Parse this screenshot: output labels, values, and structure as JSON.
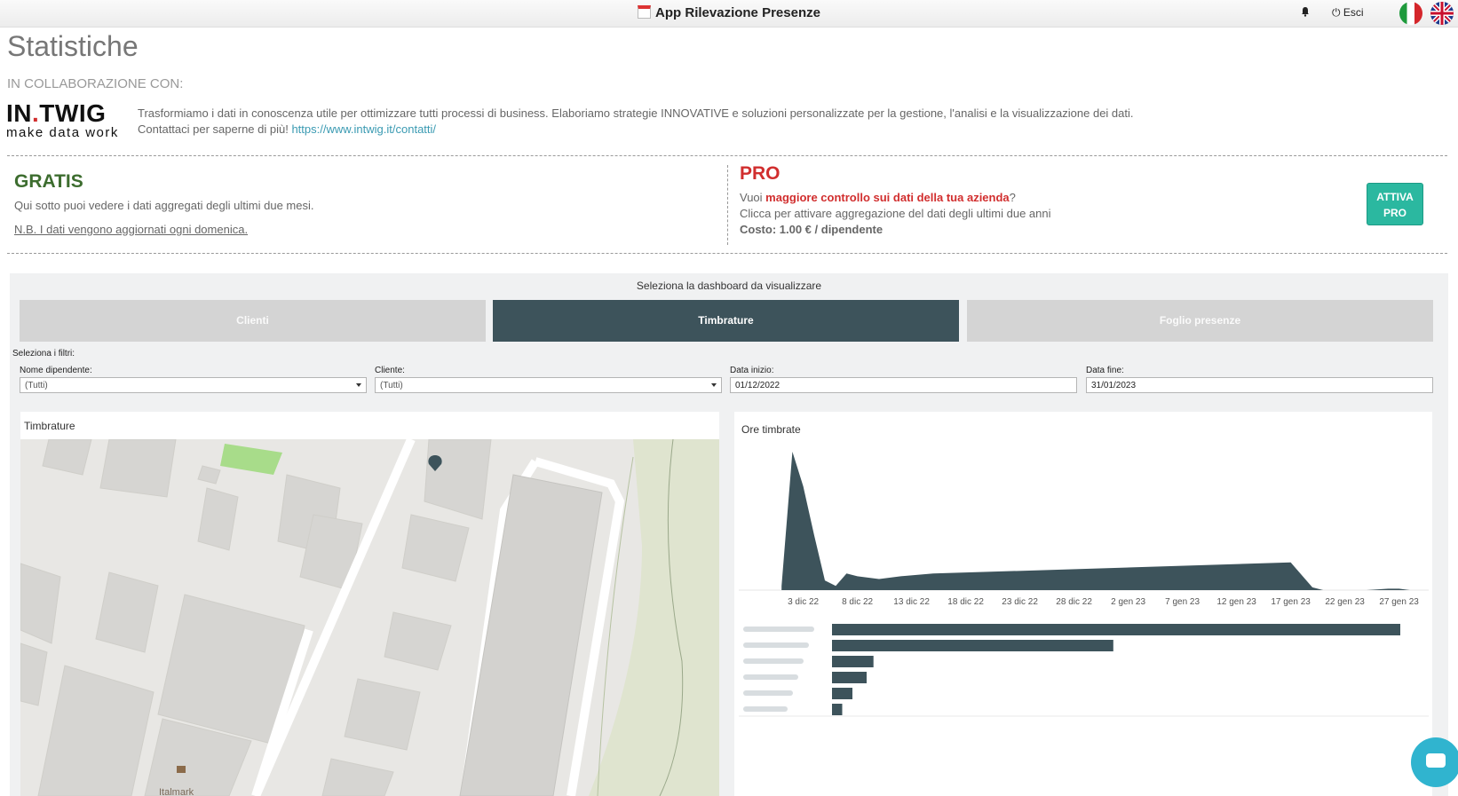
{
  "header": {
    "app_title": "App Rilevazione Presenze",
    "logout_label": "Esci",
    "icons": [
      "calendar-icon",
      "bell-icon",
      "power-icon",
      "flag-it-icon",
      "flag-en-icon"
    ]
  },
  "page": {
    "title": "Statistiche",
    "collab_label": "IN COLLABORAZIONE CON:"
  },
  "partner": {
    "logo_main": "IN.TWIG",
    "logo_sub": "make data work",
    "description": "Trasformiamo i dati in conoscenza utile per ottimizzare tutti processi di business. Elaboriamo strategie INNOVATIVE e soluzioni personalizzate per la gestione, l'analisi e la visualizzazione dei dati.",
    "contact_text": "Contattaci per saperne di più!",
    "contact_link": "https://www.intwig.it/contatti/"
  },
  "gratis": {
    "title": "GRATIS",
    "description": "Qui sotto puoi vedere i dati aggregati degli ultimi due mesi.",
    "note": "N.B. I dati vengono aggiornati ogni domenica."
  },
  "pro": {
    "title": "PRO",
    "line1_prefix": "Vuoi ",
    "line1_highlight": "maggiore controllo sui dati della tua azienda",
    "line1_suffix": "?",
    "line2": "Clicca per attivare aggregazione del dati degli ultimi due anni",
    "cost": "Costo: 1.00 € / dipendente",
    "button_line1": "ATTIVA",
    "button_line2": "PRO"
  },
  "dashboard": {
    "prompt": "Seleziona la dashboard da visualizzare",
    "tabs": [
      {
        "label": "Clienti",
        "active": false
      },
      {
        "label": "Timbrature",
        "active": true
      },
      {
        "label": "Foglio presenze",
        "active": false
      }
    ],
    "filters_label": "Seleziona i filtri:",
    "filters": {
      "employee": {
        "label": "Nome dipendente:",
        "value": "(Tutti)"
      },
      "client": {
        "label": "Cliente:",
        "value": "(Tutti)"
      },
      "start_date": {
        "label": "Data inizio:",
        "value": "01/12/2022"
      },
      "end_date": {
        "label": "Data fine:",
        "value": "31/01/2023"
      }
    }
  },
  "map": {
    "title": "Timbrature",
    "place_label": "Italmark"
  },
  "colors": {
    "accent_dark": "#3d535b",
    "gratis_green": "#3d6d2f",
    "pro_red": "#d12e2e",
    "button_teal": "#2bb8a0",
    "link_blue": "#3a9ab2"
  },
  "chart_data": [
    {
      "type": "area",
      "title": "Ore timbrate",
      "x_tick_labels": [
        "3 dic 22",
        "8 dic 22",
        "13 dic 22",
        "18 dic 22",
        "23 dic 22",
        "28 dic 22",
        "2 gen 23",
        "7 gen 23",
        "12 gen 23",
        "17 gen 23",
        "22 gen 23",
        "27 gen 23"
      ],
      "x": [
        "2022-12-01",
        "2022-12-02",
        "2022-12-03",
        "2022-12-04",
        "2022-12-05",
        "2022-12-06",
        "2022-12-07",
        "2022-12-08",
        "2022-12-10",
        "2022-12-12",
        "2022-12-15",
        "2023-01-17",
        "2023-01-19",
        "2023-01-20",
        "2023-01-22",
        "2023-01-24",
        "2023-01-26",
        "2023-01-27",
        "2023-01-28",
        "2023-01-30",
        "2023-01-31"
      ],
      "values": [
        3,
        100,
        75,
        40,
        7,
        3,
        12,
        10,
        8,
        10,
        12,
        20,
        2,
        0,
        0,
        0,
        1,
        1,
        0,
        0,
        0
      ],
      "y_axis_visible": false,
      "grid": false
    },
    {
      "type": "bar",
      "orientation": "horizontal",
      "categories_blurred": true,
      "categories": [
        "",
        "",
        "",
        "",
        "",
        ""
      ],
      "values": [
        100,
        49.5,
        7.3,
        6.1,
        3.6,
        1.8
      ]
    }
  ]
}
